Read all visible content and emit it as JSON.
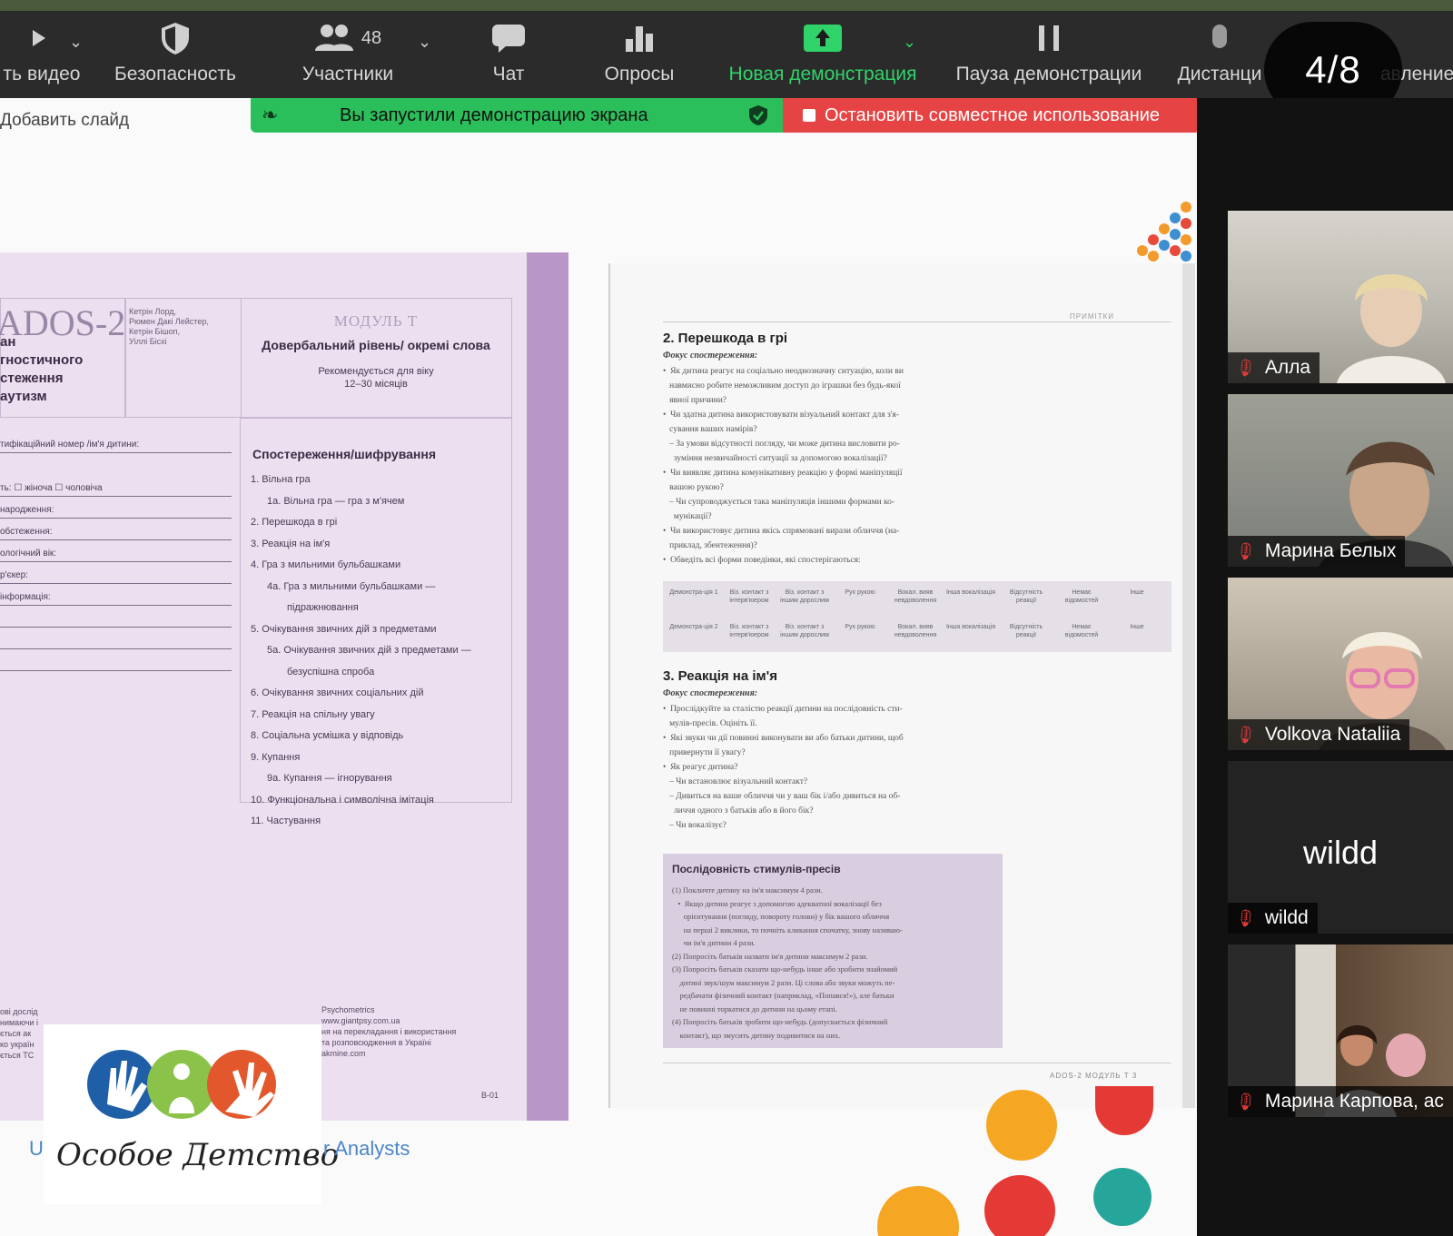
{
  "toolbar": {
    "items": [
      {
        "label": "ть видео",
        "icon": "video-camera-icon"
      },
      {
        "label": "Безопасность",
        "icon": "shield-icon"
      },
      {
        "label": "Участники",
        "icon": "participants-icon",
        "count": "48"
      },
      {
        "label": "Чат",
        "icon": "chat-bubble-icon"
      },
      {
        "label": "Опросы",
        "icon": "bar-chart-icon"
      },
      {
        "label": "Новая демонстрация",
        "icon": "share-screen-up-arrow-icon"
      },
      {
        "label": "Пауза демонстрации",
        "icon": "pause-icon"
      },
      {
        "label": "Дистанци",
        "icon": "remote-control-icon"
      },
      {
        "label": "авление"
      }
    ],
    "accent_color": "#2fd36a"
  },
  "slide_counter": "4/8",
  "share": {
    "add_slide": "Добавить слайд",
    "sharing_banner": "Вы запустили демонстрацию экрана",
    "stop_sharing": "Остановить совместное использование"
  },
  "left_page": {
    "title": "ADOS-2",
    "lines": [
      "ан",
      "гностичного",
      "стеження",
      "аутизм"
    ],
    "authors": [
      "Кетрін Лорд,",
      "Рюмен Дакі Лейстер,",
      "Кетрін Бішоп,",
      "Уіллі Бісхі"
    ],
    "module": "МОДУЛЬ Т",
    "level": "Довербальний рівень/ окремі слова",
    "recommend": [
      "Рекомендується для віку",
      "12–30 місяців"
    ],
    "form_fields": [
      "тифікаційний номер /ім'я дитини:",
      "ть: ☐ жіноча ☐ чоловіча",
      "народження:",
      "обстеження:",
      "ологічний вік:",
      "р'єкер:",
      "інформація:"
    ],
    "observation_title": "Спостереження/шифрування",
    "observations": [
      "1. Вільна гра",
      "1а. Вільна гра — гра з м'ячем",
      "2. Перешкода в грі",
      "3. Реакція на ім'я",
      "4. Гра з мильними бульбашками",
      "4а. Гра з мильними бульбашками —",
      "підражнювання",
      "5. Очікування звичних дій з предметами",
      "5а. Очікування звичних дій з предметами —",
      "безуспішна спроба",
      "6. Очікування звичних соціальних дій",
      "7. Реакція на спільну увагу",
      "8. Соціальна усмішка у відповідь",
      "9. Купання",
      "9а. Купання — ігнорування",
      "10. Функціональна і символічна імітація",
      "11. Частування"
    ],
    "bottom_left": [
      "ові дослід",
      "нимаючи і",
      "ється ак",
      "ко україн",
      "ється TC"
    ],
    "bottom_right": [
      "Psychometrics",
      "www.giantpsy.com.ua",
      "ня на перекладання і використання",
      "та розповсюдження в Україні",
      "akmine.com"
    ],
    "page_no": "B-01"
  },
  "right_page": {
    "notes_label": "ПРИМІТКИ",
    "section2_title": "2. Перешкода в грі",
    "focus_label": "Фокус спостереження:",
    "section2_text": [
      "•  Як дитина реагує на соціально неоднозначну ситуацію, коли ви",
      "   навмисно робите неможливим доступ до іграшки без будь-якої",
      "   явної причини?",
      "•  Чи здатна дитина використовувати візуальний контакт для з'я-",
      "   сування ваших намірів?",
      "   – За умови відсутності погляду, чи може дитина висловити ро-",
      "     зуміння незвичайності ситуації за допомогою вокалізації?",
      "•  Чи виявляє дитина комунікативну реакцію у формі маніпуляції",
      "   вашою рукою?",
      "   – Чи супроводжується така маніпуляція іншими формами ко-",
      "     мунікації?",
      "•  Чи використовує дитина якісь спрямовані вирази обличчя (на-",
      "   приклад, збентеження)?",
      "•  Обведіть всі форми поведінки, які спостерігаються:"
    ],
    "table_cells": [
      "Демонстра-ція 1",
      "Віз. контакт з інтерв'юером",
      "Віз. контакт з іншим дорослим",
      "Рух рукою",
      "Вокал. вияв невдоволення",
      "Інша вокалізація",
      "Відсутність реакції",
      "Немає відомостей",
      "Інше"
    ],
    "table_cells_2": [
      "Демонстра-ція 2",
      "Віз. контакт з інтерв'юером",
      "Віз. контакт з іншим дорослим",
      "Рух рукою",
      "Вокал. вияв невдоволення",
      "Інша вокалізація",
      "Відсутність реакції",
      "Немає відомостей",
      "Інше"
    ],
    "section3_title": "3. Реакція на ім'я",
    "section3_text": [
      "•  Прослідкуйте за сталістю реакції дитини на послідовність сти-",
      "   мулів-пресів. Оцініть її.",
      "•  Які звуки чи дії повинні виконувати ви або батьки дитини, щоб",
      "   привернути її увагу?",
      "•  Як реагує дитина?",
      "   – Чи встановлює візуальний контакт?",
      "   – Дивиться на ваше обличчя чи у ваш бік і/або дивиться на об-",
      "     личчя одного з батьків або в його бік?",
      "   – Чи вокалізує?"
    ],
    "stimulus_title": "Послідовність стимулів-пресів",
    "stimulus_text": [
      "(1) Покличте дитину на ім'я максимум 4 рази.",
      "   •  Якщо дитина реагує з допомогою адекватної вокалізації без",
      "      орієнтування (погляду, повороту голови) у бік вашого обличчя",
      "      на перші 2 виклики, то почніть кликання спочатку, знову називаю-",
      "      чи ім'я дитини 4 рази.",
      "(2) Попросіть батьків назвати ім'я дитини максимум 2 рази.",
      "(3) Попросіть батьків сказати що-небудь інше або зробити знайомий",
      "    дитині звук/шум максимум 2 рази. Ці слова або звуки можуть пе-",
      "    редбачати фізичний контакт (наприклад, «Попався!»), але батьки",
      "    не повинні торкатися до дитини на цьому етапі.",
      "(4) Попросіть батьків зробити що-небудь (допускається фізичний",
      "    контакт), що змусить дитину подивитися на них."
    ],
    "footer": "ADOS-2  МОДУЛЬ Т    3"
  },
  "logo": {
    "text": "Особое Детство",
    "analysts_prefix": "U",
    "analysts": "r Analysts"
  },
  "participants": [
    {
      "name": "Алла",
      "muted": true,
      "bg": "#bfbfb8"
    },
    {
      "name": "Марина Белых",
      "muted": true,
      "bg": "#8b8c84"
    },
    {
      "name": "Volkova Nataliia",
      "muted": true,
      "bg": "#a8a195"
    },
    {
      "name": "wildd",
      "muted": true,
      "video": false,
      "bg": "#232323"
    },
    {
      "name": "Марина Карпова, ас",
      "muted": true,
      "bg": "#6e5a4a"
    }
  ],
  "colors": {
    "green_banner": "#2bbf5b",
    "red_banner": "#e64444",
    "mute_icon": "#e23b3b"
  }
}
